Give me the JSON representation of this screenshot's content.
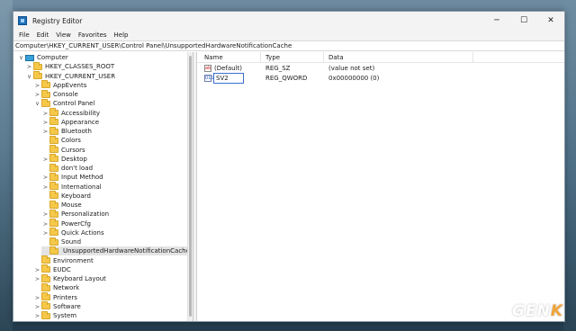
{
  "window": {
    "title": "Registry Editor",
    "controls": {
      "minimize": "─",
      "maximize": "☐",
      "close": "✕"
    }
  },
  "menu": [
    "File",
    "Edit",
    "View",
    "Favorites",
    "Help"
  ],
  "address": "Computer\\HKEY_CURRENT_USER\\Control Panel\\UnsupportedHardwareNotificationCache",
  "tree": [
    {
      "label": "Computer",
      "depth": 0,
      "caret": "∨",
      "icon": "computer-icon"
    },
    {
      "label": "HKEY_CLASSES_ROOT",
      "depth": 1,
      "caret": ">",
      "icon": "folder-icon"
    },
    {
      "label": "HKEY_CURRENT_USER",
      "depth": 1,
      "caret": "∨",
      "icon": "folder-icon"
    },
    {
      "label": "AppEvents",
      "depth": 2,
      "caret": ">",
      "icon": "folder-icon"
    },
    {
      "label": "Console",
      "depth": 2,
      "caret": ">",
      "icon": "folder-icon"
    },
    {
      "label": "Control Panel",
      "depth": 2,
      "caret": "∨",
      "icon": "folder-icon"
    },
    {
      "label": "Accessibility",
      "depth": 3,
      "caret": ">",
      "icon": "folder-icon"
    },
    {
      "label": "Appearance",
      "depth": 3,
      "caret": ">",
      "icon": "folder-icon"
    },
    {
      "label": "Bluetooth",
      "depth": 3,
      "caret": ">",
      "icon": "folder-icon"
    },
    {
      "label": "Colors",
      "depth": 3,
      "caret": "",
      "icon": "folder-icon"
    },
    {
      "label": "Cursors",
      "depth": 3,
      "caret": "",
      "icon": "folder-icon"
    },
    {
      "label": "Desktop",
      "depth": 3,
      "caret": ">",
      "icon": "folder-icon"
    },
    {
      "label": "don't load",
      "depth": 3,
      "caret": "",
      "icon": "folder-icon"
    },
    {
      "label": "Input Method",
      "depth": 3,
      "caret": ">",
      "icon": "folder-icon"
    },
    {
      "label": "International",
      "depth": 3,
      "caret": ">",
      "icon": "folder-icon"
    },
    {
      "label": "Keyboard",
      "depth": 3,
      "caret": "",
      "icon": "folder-icon"
    },
    {
      "label": "Mouse",
      "depth": 3,
      "caret": "",
      "icon": "folder-icon"
    },
    {
      "label": "Personalization",
      "depth": 3,
      "caret": ">",
      "icon": "folder-icon"
    },
    {
      "label": "PowerCfg",
      "depth": 3,
      "caret": ">",
      "icon": "folder-icon"
    },
    {
      "label": "Quick Actions",
      "depth": 3,
      "caret": ">",
      "icon": "folder-icon"
    },
    {
      "label": "Sound",
      "depth": 3,
      "caret": "",
      "icon": "folder-icon"
    },
    {
      "label": "UnsupportedHardwareNotificationCache",
      "depth": 3,
      "caret": "",
      "icon": "folder-icon",
      "selected": true
    },
    {
      "label": "Environment",
      "depth": 2,
      "caret": "",
      "icon": "folder-icon"
    },
    {
      "label": "EUDC",
      "depth": 2,
      "caret": ">",
      "icon": "folder-icon"
    },
    {
      "label": "Keyboard Layout",
      "depth": 2,
      "caret": ">",
      "icon": "folder-icon"
    },
    {
      "label": "Network",
      "depth": 2,
      "caret": "",
      "icon": "folder-icon"
    },
    {
      "label": "Printers",
      "depth": 2,
      "caret": ">",
      "icon": "folder-icon"
    },
    {
      "label": "Software",
      "depth": 2,
      "caret": ">",
      "icon": "folder-icon"
    },
    {
      "label": "System",
      "depth": 2,
      "caret": ">",
      "icon": "folder-icon"
    }
  ],
  "list": {
    "headers": {
      "name": "Name",
      "type": "Type",
      "data": "Data"
    },
    "rows": [
      {
        "name": "(Default)",
        "type": "REG_SZ",
        "data": "(value not set)",
        "icon_text": "ab",
        "icon": "string-value-icon"
      },
      {
        "name": "SV2",
        "type": "REG_QWORD",
        "data": "0x00000000 (0)",
        "icon_text": "011",
        "icon": "binary-value-icon",
        "editing": true
      }
    ]
  },
  "watermark": {
    "main": "GEN",
    "accent": "K"
  }
}
